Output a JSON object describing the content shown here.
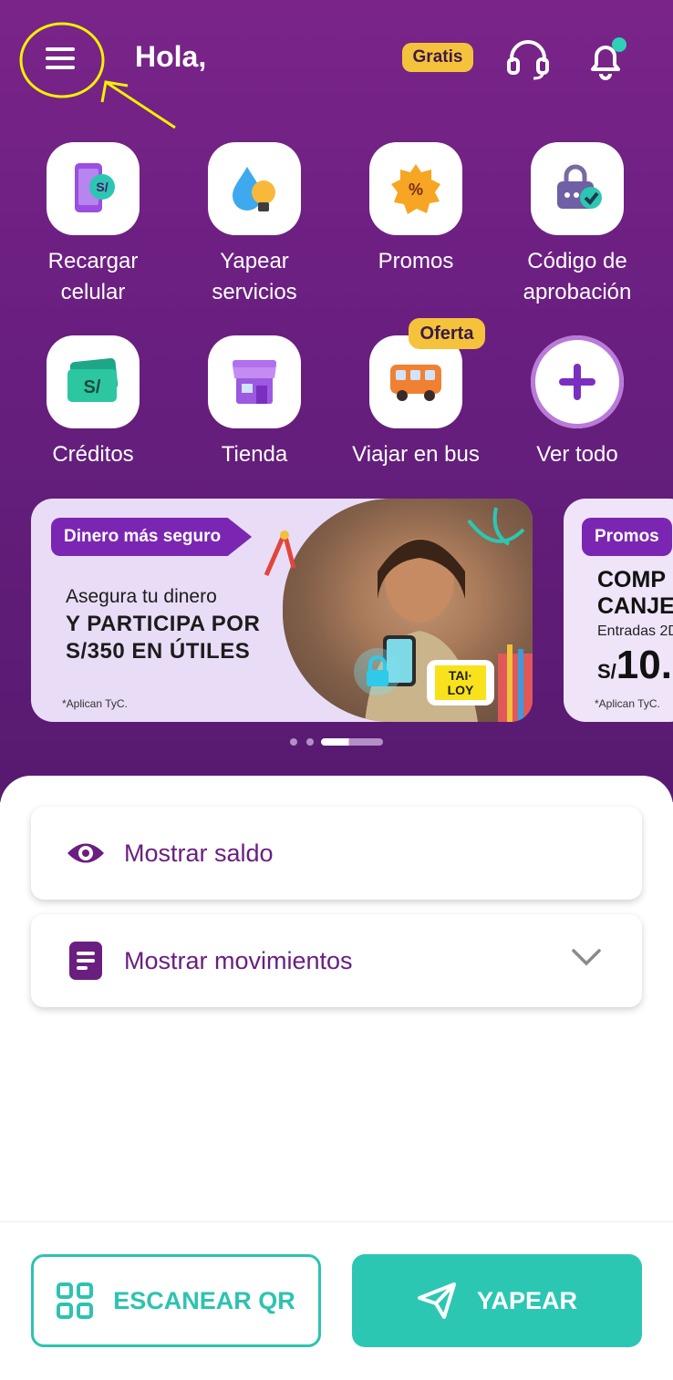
{
  "header": {
    "greeting": "Hola,",
    "free_badge": "Gratis",
    "support_icon": "headset-icon",
    "notifications_icon": "bell-icon",
    "menu_icon": "hamburger-menu-icon"
  },
  "shortcuts": [
    {
      "label_line1": "Recargar",
      "label_line2": "celular",
      "icon": "phone-recharge-icon"
    },
    {
      "label_line1": "Yapear",
      "label_line2": "servicios",
      "icon": "services-drop-bulb-icon"
    },
    {
      "label_line1": "Promos",
      "label_line2": "",
      "icon": "promo-badge-icon"
    },
    {
      "label_line1": "Código de",
      "label_line2": "aprobación",
      "icon": "lock-check-icon"
    },
    {
      "label_line1": "Créditos",
      "label_line2": "",
      "icon": "money-bill-icon"
    },
    {
      "label_line1": "Tienda",
      "label_line2": "",
      "icon": "store-icon"
    },
    {
      "label_line1": "Viajar en bus",
      "label_line2": "",
      "icon": "bus-icon"
    },
    {
      "label_line1": "Ver todo",
      "label_line2": "",
      "icon": "plus-icon"
    }
  ],
  "offer_badge": "Oferta",
  "banners": [
    {
      "tag": "Dinero más seguro",
      "line1": "Asegura tu dinero",
      "line2": "Y PARTICIPA POR",
      "line3": "S/350 EN ÚTILES",
      "legal": "*Aplican TyC.",
      "brand": "TAI-LOY"
    },
    {
      "tag": "Promos",
      "line1": "COMP",
      "line2": "CANJE",
      "line3": "Entradas 2D",
      "price_currency": "S/",
      "price": "10.",
      "legal": "*Aplican TyC."
    }
  ],
  "carousel": {
    "count": 3,
    "active": 2
  },
  "balance": {
    "label": "Mostrar saldo",
    "icon": "eye-icon"
  },
  "movements": {
    "label": "Mostrar movimientos",
    "icon": "document-list-icon"
  },
  "actions": {
    "scan_label": "ESCANEAR QR",
    "yapear_label": "YAPEAR"
  },
  "colors": {
    "brand_purple": "#742087",
    "accent_teal": "#2cc7b3",
    "badge_yellow": "#f5c33b"
  }
}
